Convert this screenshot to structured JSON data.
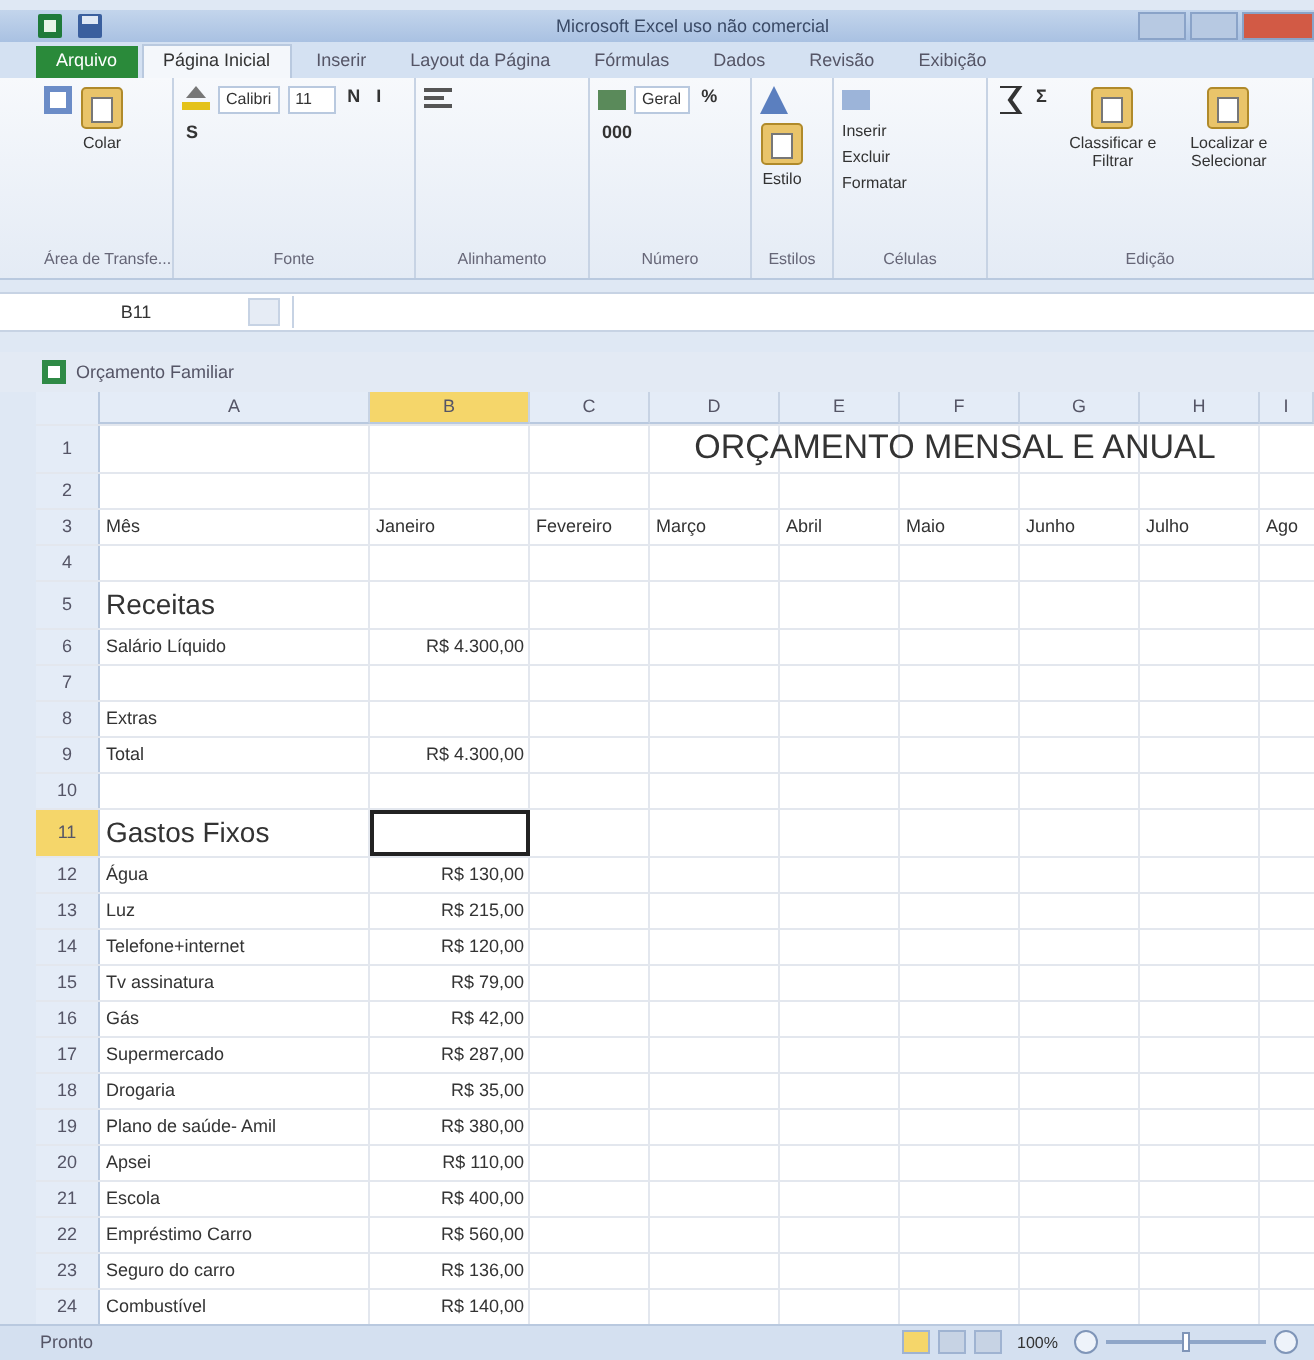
{
  "window": {
    "title": "Microsoft Excel uso não comercial"
  },
  "tabs": [
    {
      "label": "Arquivo",
      "kind": "file",
      "selected": false
    },
    {
      "label": "Página Inicial",
      "kind": "tab",
      "selected": true
    },
    {
      "label": "Inserir",
      "kind": "tab",
      "selected": false
    },
    {
      "label": "Layout da Página",
      "kind": "tab",
      "selected": false
    },
    {
      "label": "Fórmulas",
      "kind": "tab",
      "selected": false
    },
    {
      "label": "Dados",
      "kind": "tab",
      "selected": false
    },
    {
      "label": "Revisão",
      "kind": "tab",
      "selected": false
    },
    {
      "label": "Exibição",
      "kind": "tab",
      "selected": false
    }
  ],
  "ribbon": {
    "groups": [
      {
        "label": "Área de Transfe...",
        "items": [
          {
            "kind": "big",
            "label": "Colar"
          }
        ]
      },
      {
        "label": "Fonte",
        "items": [
          {
            "kind": "field",
            "label": "Calibri"
          },
          {
            "kind": "field",
            "label": "11"
          },
          {
            "kind": "glyph",
            "label": "N"
          },
          {
            "kind": "glyph",
            "label": "I"
          },
          {
            "kind": "glyph",
            "label": "S"
          }
        ]
      },
      {
        "label": "Alinhamento"
      },
      {
        "label": "Número",
        "items": [
          {
            "kind": "field",
            "label": "Geral"
          },
          {
            "kind": "glyph",
            "label": "%"
          },
          {
            "kind": "glyph",
            "label": "000"
          }
        ]
      },
      {
        "label": "Estilos",
        "items": [
          {
            "kind": "big",
            "label": "Estilo"
          }
        ]
      },
      {
        "label": "Células",
        "items": [
          {
            "kind": "small",
            "label": "Inserir"
          },
          {
            "kind": "small",
            "label": "Excluir"
          },
          {
            "kind": "small",
            "label": "Formatar"
          }
        ]
      },
      {
        "label": "Edição",
        "items": [
          {
            "kind": "glyph",
            "label": "Σ"
          },
          {
            "kind": "big",
            "label": "Classificar e Filtrar"
          },
          {
            "kind": "big",
            "label": "Localizar e Selecionar"
          }
        ]
      }
    ]
  },
  "formula_bar": {
    "cell": "B11"
  },
  "workbook": {
    "title": "Orçamento Familiar"
  },
  "sheet": {
    "columns": [
      {
        "label": "A",
        "selected": false
      },
      {
        "label": "B",
        "selected": true
      },
      {
        "label": "C",
        "selected": false
      },
      {
        "label": "D",
        "selected": false
      },
      {
        "label": "E",
        "selected": false
      },
      {
        "label": "F",
        "selected": false
      },
      {
        "label": "G",
        "selected": false
      },
      {
        "label": "H",
        "selected": false
      },
      {
        "label": "I",
        "selected": false
      }
    ],
    "rows": [
      {
        "number": "1",
        "kind": "title",
        "selected": false,
        "cells": [
          {
            "selected": false
          },
          {
            "selected": false
          },
          {
            "selected": false
          },
          {
            "text": "ORÇAMENTO MENSAL E ANUAL",
            "selected": false
          }
        ]
      },
      {
        "number": "2",
        "kind": "blank",
        "selected": false,
        "cells": []
      },
      {
        "number": "3",
        "kind": "header",
        "selected": false,
        "cells": [
          {
            "text": "Mês",
            "selected": false
          },
          {
            "text": "Janeiro",
            "selected": false
          },
          {
            "text": "Fevereiro",
            "selected": false
          },
          {
            "text": "Março",
            "selected": false
          },
          {
            "text": "Abril",
            "selected": false
          },
          {
            "text": "Maio",
            "selected": false
          },
          {
            "text": "Junho",
            "selected": false
          },
          {
            "text": "Julho",
            "selected": false
          },
          {
            "text": "Ago",
            "selected": false
          }
        ]
      },
      {
        "number": "4",
        "kind": "blank",
        "selected": false,
        "cells": []
      },
      {
        "number": "5",
        "kind": "heading",
        "selected": false,
        "cells": [
          {
            "text": "Receitas",
            "selected": false
          }
        ]
      },
      {
        "number": "6",
        "kind": "item",
        "selected": false,
        "cells": [
          {
            "text": "Salário Líquido",
            "selected": false
          },
          {
            "text": "R$ 4.300,00",
            "selected": false
          }
        ]
      },
      {
        "number": "7",
        "kind": "blank",
        "selected": false,
        "cells": []
      },
      {
        "number": "8",
        "kind": "item",
        "selected": false,
        "cells": [
          {
            "text": "Extras",
            "selected": false
          }
        ]
      },
      {
        "number": "9",
        "kind": "item",
        "selected": false,
        "cells": [
          {
            "text": "Total",
            "selected": false
          },
          {
            "text": "R$ 4.300,00",
            "selected": false
          }
        ]
      },
      {
        "number": "10",
        "kind": "blank",
        "selected": false,
        "cells": []
      },
      {
        "number": "11",
        "kind": "heading",
        "selected": true,
        "cells": [
          {
            "text": "Gastos Fixos",
            "selected": false
          },
          {
            "selected": true
          }
        ]
      },
      {
        "number": "12",
        "kind": "item",
        "selected": false,
        "cells": [
          {
            "text": "Água",
            "selected": false
          },
          {
            "text": "R$ 130,00",
            "selected": false
          }
        ]
      },
      {
        "number": "13",
        "kind": "item",
        "selected": false,
        "cells": [
          {
            "text": "Luz",
            "selected": false
          },
          {
            "text": "R$ 215,00",
            "selected": false
          }
        ]
      },
      {
        "number": "14",
        "kind": "item",
        "selected": false,
        "cells": [
          {
            "text": "Telefone+internet",
            "selected": false
          },
          {
            "text": "R$ 120,00",
            "selected": false
          }
        ]
      },
      {
        "number": "15",
        "kind": "item",
        "selected": false,
        "cells": [
          {
            "text": "Tv assinatura",
            "selected": false
          },
          {
            "text": "R$ 79,00",
            "selected": false
          }
        ]
      },
      {
        "number": "16",
        "kind": "item",
        "selected": false,
        "cells": [
          {
            "text": "Gás",
            "selected": false
          },
          {
            "text": "R$ 42,00",
            "selected": false
          }
        ]
      },
      {
        "number": "17",
        "kind": "item",
        "selected": false,
        "cells": [
          {
            "text": "Supermercado",
            "selected": false
          },
          {
            "text": "R$ 287,00",
            "selected": false
          }
        ]
      },
      {
        "number": "18",
        "kind": "item",
        "selected": false,
        "cells": [
          {
            "text": "Drogaria",
            "selected": false
          },
          {
            "text": "R$ 35,00",
            "selected": false
          }
        ]
      },
      {
        "number": "19",
        "kind": "item",
        "selected": false,
        "cells": [
          {
            "text": "Plano de saúde- Amil",
            "selected": false
          },
          {
            "text": "R$ 380,00",
            "selected": false
          }
        ]
      },
      {
        "number": "20",
        "kind": "item",
        "selected": false,
        "cells": [
          {
            "text": "Apsei",
            "selected": false
          },
          {
            "text": "R$ 110,00",
            "selected": false
          }
        ]
      },
      {
        "number": "21",
        "kind": "item",
        "selected": false,
        "cells": [
          {
            "text": "Escola",
            "selected": false
          },
          {
            "text": "R$ 400,00",
            "selected": false
          }
        ]
      },
      {
        "number": "22",
        "kind": "item",
        "selected": false,
        "cells": [
          {
            "text": "Empréstimo Carro",
            "selected": false
          },
          {
            "text": "R$ 560,00",
            "selected": false
          }
        ]
      },
      {
        "number": "23",
        "kind": "item",
        "selected": false,
        "cells": [
          {
            "text": "Seguro do carro",
            "selected": false
          },
          {
            "text": "R$ 136,00",
            "selected": false
          }
        ]
      },
      {
        "number": "24",
        "kind": "item",
        "selected": false,
        "cells": [
          {
            "text": "Combustível",
            "selected": false
          },
          {
            "text": "R$ 140,00",
            "selected": false
          }
        ]
      }
    ]
  },
  "status_bar": {
    "status": "Pronto",
    "zoom": "100%",
    "zoom_level": {
      "level": 0.5
    }
  }
}
